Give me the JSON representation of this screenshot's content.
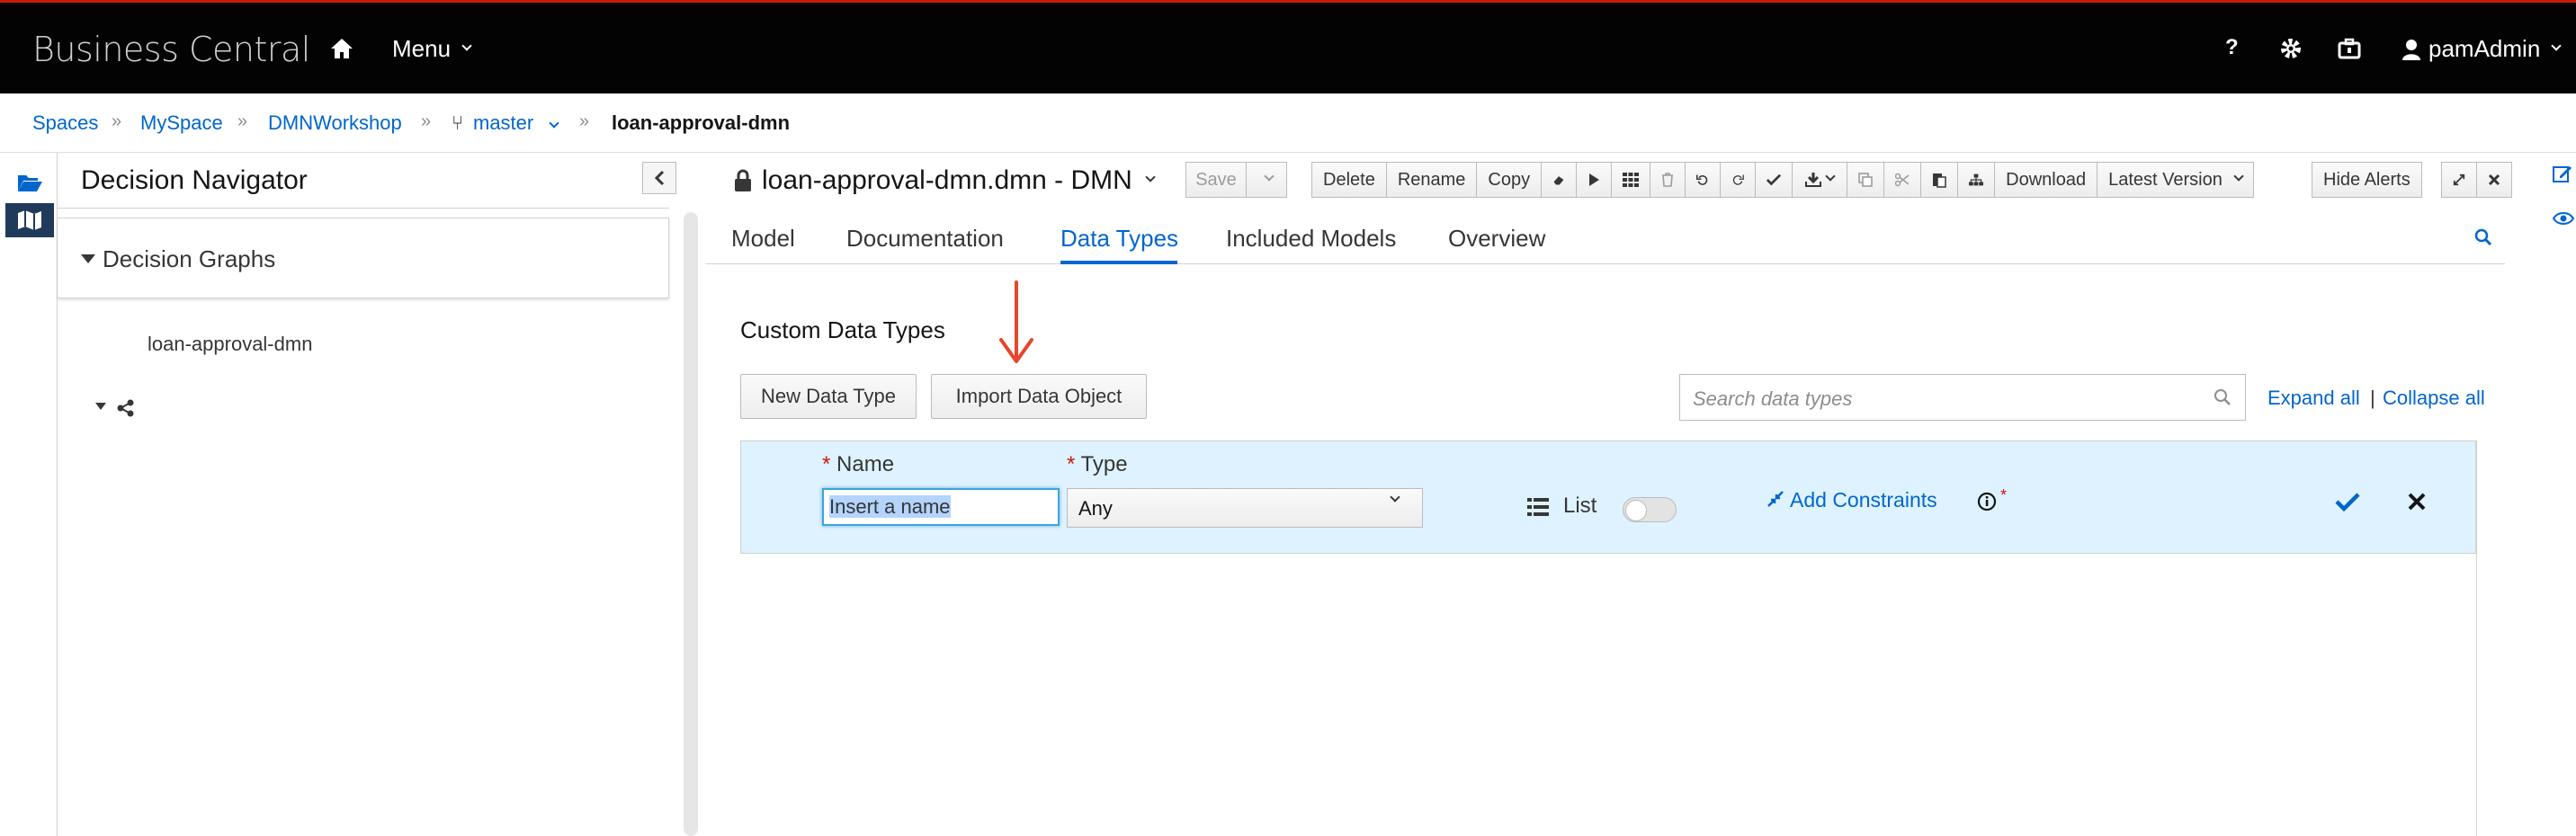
{
  "header": {
    "brand": "Business Central",
    "menu_label": "Menu",
    "help_label": "?",
    "user_label": "pamAdmin"
  },
  "breadcrumb": {
    "items": [
      "Spaces",
      "MySpace",
      "DMNWorkshop",
      "master"
    ],
    "current": "loan-approval-dmn"
  },
  "navigator": {
    "title": "Decision Navigator",
    "section_title": "Decision Graphs",
    "tree_item": "loan-approval-dmn"
  },
  "editor": {
    "title": "loan-approval-dmn.dmn - DMN",
    "toolbar": {
      "save": "Save",
      "delete": "Delete",
      "rename": "Rename",
      "copy": "Copy",
      "download": "Download",
      "latest_version": "Latest Version",
      "hide_alerts": "Hide Alerts"
    },
    "tabs": [
      "Model",
      "Documentation",
      "Data Types",
      "Included Models",
      "Overview"
    ],
    "active_tab": "Data Types"
  },
  "data_types": {
    "section_title": "Custom Data Types",
    "new_button": "New Data Type",
    "import_button": "Import Data Object",
    "search_placeholder": "Search data types",
    "expand_all": "Expand all",
    "separator": "|",
    "collapse_all": "Collapse all",
    "row": {
      "name_label": "Name",
      "type_label": "Type",
      "required_mark": "*",
      "name_value": "Insert a name",
      "type_value": "Any",
      "list_label": "List",
      "list_enabled": false,
      "constraints_label": "Add Constraints"
    }
  },
  "colors": {
    "accent": "#0066cc",
    "topbar": "#030303",
    "row_highlight": "#def3ff",
    "annotation_arrow": "#e8452c"
  }
}
